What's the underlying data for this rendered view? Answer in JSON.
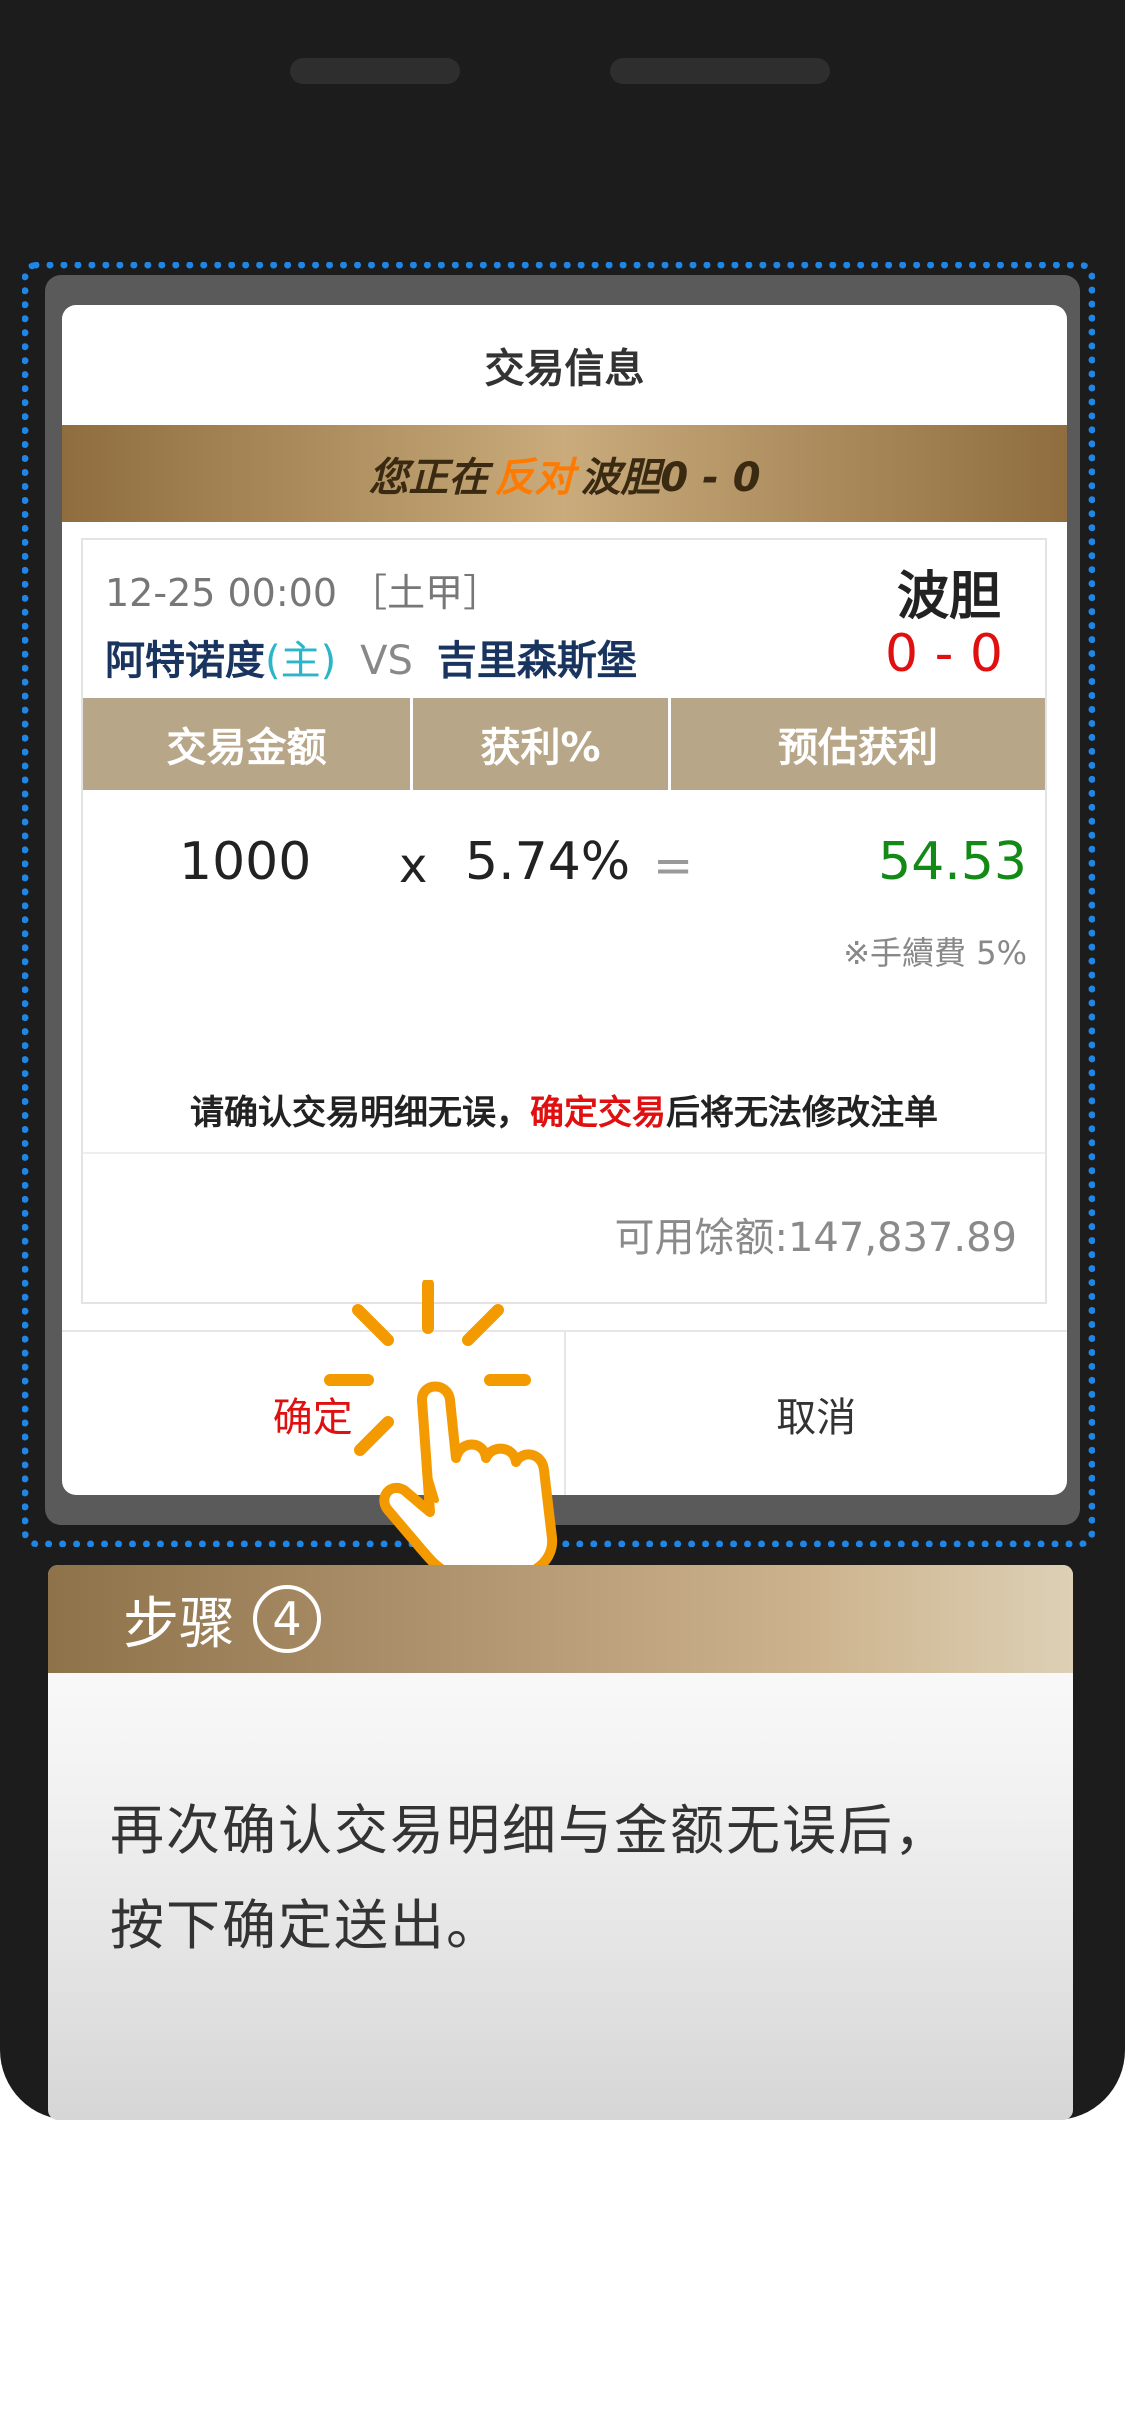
{
  "dialog": {
    "title": "交易信息",
    "banner": {
      "prefix": "您正在",
      "action": "反对",
      "suffix": "波胆0 - 0"
    },
    "match": {
      "time": "12-25 00:00 ［土甲］",
      "home_team": "阿特诺度",
      "home_tag": "(主)",
      "vs": "VS",
      "away_team": "吉里森斯堡",
      "bet_type": "波胆",
      "score": "0 - 0"
    },
    "table": {
      "headers": [
        "交易金额",
        "获利%",
        "预估获利"
      ],
      "amount": "1000",
      "multiply": "x",
      "rate": "5.74%",
      "equals": "=",
      "profit": "54.53",
      "fee": "※手續費 5%"
    },
    "notice": {
      "pre": "请确认交易明细无误，",
      "emph": "确定交易",
      "post": "后将无法修改注单"
    },
    "balance": "可用馀额:147,837.89",
    "buttons": {
      "confirm": "确定",
      "cancel": "取消"
    }
  },
  "step": {
    "label": "步骤",
    "number": "4",
    "description_line1": "再次确认交易明细与金额无误后，",
    "description_line2": "按下确定送出。"
  },
  "colors": {
    "accent_red": "#e01010",
    "profit_green": "#138a15",
    "highlight_blue": "#1f86e6",
    "tap_orange": "#f39a00",
    "header_gold": "#b8a688"
  },
  "icons": [
    "tap-hand-icon"
  ]
}
